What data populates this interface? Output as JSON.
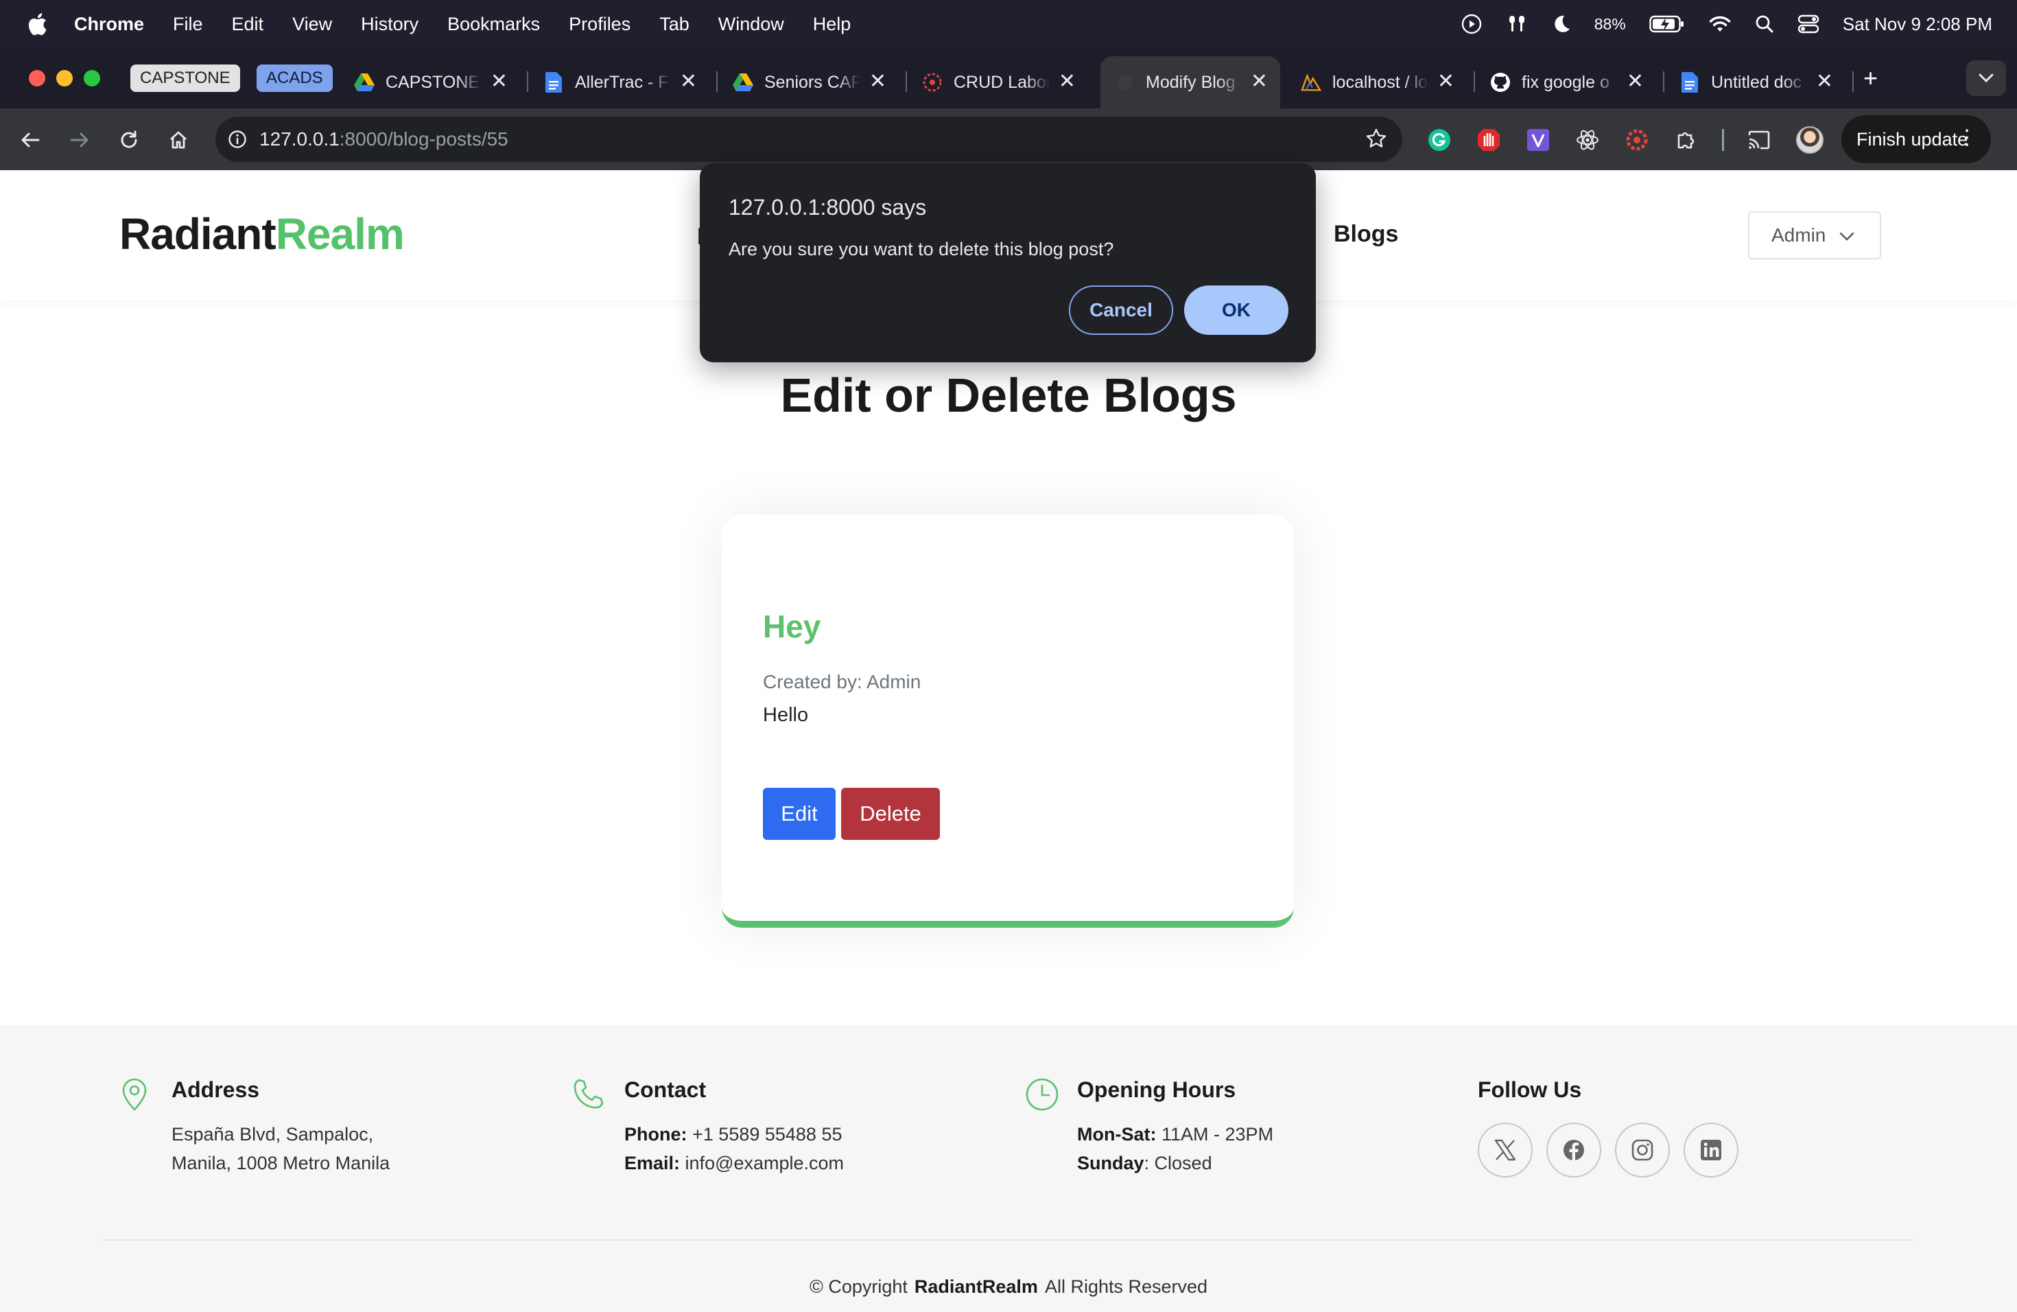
{
  "menubar": {
    "app_name": "Chrome",
    "items": [
      "File",
      "Edit",
      "View",
      "History",
      "Bookmarks",
      "Profiles",
      "Tab",
      "Window",
      "Help"
    ],
    "battery": "88%",
    "datetime": "Sat Nov 9  2:08 PM"
  },
  "tab_groups": [
    "CAPSTONE",
    "ACADS"
  ],
  "tabs": [
    {
      "title": "CAPSTONE",
      "icon": "google-drive-icon"
    },
    {
      "title": "AllerTrac - F",
      "icon": "google-docs-icon"
    },
    {
      "title": "Seniors CAP",
      "icon": "google-drive-icon"
    },
    {
      "title": "CRUD Labor",
      "icon": "crud-site-icon"
    },
    {
      "title": "Modify Blog",
      "icon": "page-icon",
      "active": true
    },
    {
      "title": "localhost / lo",
      "icon": "phpmyadmin-icon"
    },
    {
      "title": "fix google o",
      "icon": "github-icon"
    },
    {
      "title": "Untitled doc",
      "icon": "google-docs-icon"
    }
  ],
  "toolbar": {
    "url_host": "127.0.0.1",
    "url_path": ":8000/blog-posts/55",
    "finish_update": "Finish update"
  },
  "header": {
    "logo_main": "Radiant",
    "logo_accent": "Realm",
    "nav_partial": "H",
    "nav_blogs": "Blogs",
    "admin_label": "Admin"
  },
  "main": {
    "title": "Edit or Delete Blogs",
    "post": {
      "title": "Hey",
      "meta": "Created by: Admin",
      "body": "Hello",
      "edit_label": "Edit",
      "delete_label": "Delete"
    }
  },
  "dialog": {
    "title": "127.0.0.1:8000 says",
    "message": "Are you sure you want to delete this blog post?",
    "cancel_label": "Cancel",
    "ok_label": "OK"
  },
  "footer": {
    "address": {
      "heading": "Address",
      "line1": "España Blvd, Sampaloc,",
      "line2": "Manila, 1008 Metro Manila"
    },
    "contact": {
      "heading": "Contact",
      "phone_label": "Phone:",
      "phone": "+1 5589 55488 55",
      "email_label": "Email:",
      "email": "info@example.com"
    },
    "hours": {
      "heading": "Opening Hours",
      "weekday_label": "Mon-Sat:",
      "weekday": "11AM - 23PM",
      "sunday_label": "Sunday",
      "sunday": ": Closed"
    },
    "follow": {
      "heading": "Follow Us",
      "socials": [
        "x-icon",
        "facebook-icon",
        "instagram-icon",
        "linkedin-icon"
      ]
    },
    "copyright_prefix": "© Copyright",
    "copyright_brand": "RadiantRealm",
    "copyright_suffix": "All Rights Reserved"
  },
  "colors": {
    "accent_green": "#5cc16d",
    "edit_blue": "#2d6bf0",
    "delete_red": "#b3343d"
  }
}
